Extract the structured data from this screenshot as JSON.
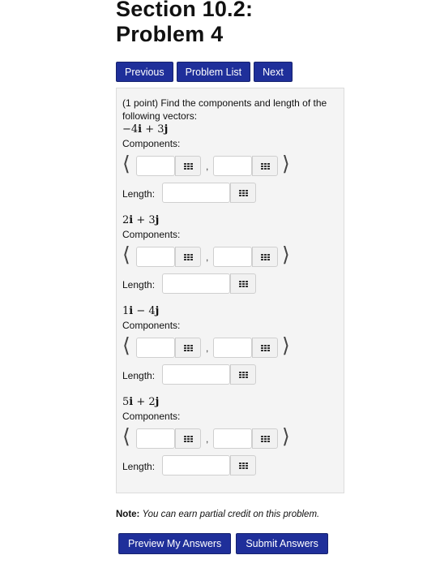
{
  "page": {
    "title_line1": "Section 10.2:",
    "title_line2": "Problem 4"
  },
  "nav": {
    "previous": "Previous",
    "problem_list": "Problem List",
    "next": "Next"
  },
  "problem": {
    "intro_line1": "(1 point) Find the components and length of the",
    "intro_line2": "following vectors:",
    "components_label": "Components:",
    "length_label": "Length:",
    "left_angle": "⟨",
    "right_angle": "⟩",
    "comma": ",",
    "vectors": [
      {
        "a": "−4",
        "b": "+ 3"
      },
      {
        "a": "2",
        "b": "+ 3"
      },
      {
        "a": "1",
        "b": "− 4"
      },
      {
        "a": "5",
        "b": "+ 2"
      }
    ]
  },
  "note": {
    "label": "Note:",
    "text": "You can earn partial credit on this problem."
  },
  "actions": {
    "preview": "Preview My Answers",
    "submit": "Submit Answers"
  },
  "colors": {
    "button_bg": "#1f2f9a",
    "panel_bg": "#f4f4f4"
  }
}
